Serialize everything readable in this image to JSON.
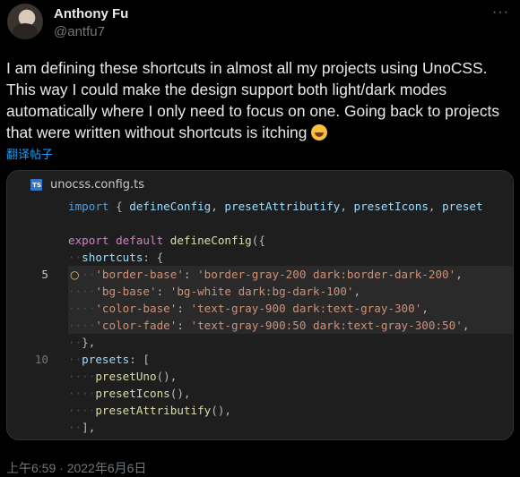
{
  "author": {
    "name": "Anthony Fu",
    "handle": "@antfu7"
  },
  "tweet": {
    "text": "I am defining these shortcuts in almost all my projects using UnoCSS. This way I could make the design support both light/dark modes automatically where I only need to focus on one. Going back to projects that were written without shortcuts is itching",
    "emoji": "rolling-on-the-floor-laughing",
    "translate_label": "翻译帖子",
    "more_label": "···"
  },
  "code_card": {
    "file_badge": "TS",
    "filename": "unocss.config.ts",
    "lines": [
      {
        "num": "",
        "tokens": [
          [
            "k",
            "import"
          ],
          [
            "pun",
            " { "
          ],
          [
            "p",
            "defineConfig"
          ],
          [
            "pun",
            ", "
          ],
          [
            "p",
            "presetAttributify"
          ],
          [
            "pun",
            ", "
          ],
          [
            "p",
            "presetIcons"
          ],
          [
            "pun",
            ", "
          ],
          [
            "p",
            "preset"
          ]
        ]
      },
      {
        "num": "",
        "tokens": []
      },
      {
        "num": "",
        "tokens": [
          [
            "kw",
            "export"
          ],
          [
            "pun",
            " "
          ],
          [
            "kw",
            "default"
          ],
          [
            "pun",
            " "
          ],
          [
            "f",
            "defineConfig"
          ],
          [
            "pun",
            "({"
          ]
        ]
      },
      {
        "num": "",
        "tokens": [
          [
            "dot",
            "··"
          ],
          [
            "p",
            "shortcuts"
          ],
          [
            "pun",
            ": {"
          ]
        ]
      },
      {
        "num": "5",
        "tokens": [
          [
            "dot",
            "····"
          ],
          [
            "s",
            "'border-base'"
          ],
          [
            "pun",
            ": "
          ],
          [
            "s",
            "'border-gray-200 dark:border-dark-200'"
          ],
          [
            "pun",
            ","
          ]
        ]
      },
      {
        "num": "",
        "tokens": [
          [
            "dot",
            "····"
          ],
          [
            "s",
            "'bg-base'"
          ],
          [
            "pun",
            ": "
          ],
          [
            "s",
            "'bg-white dark:bg-dark-100'"
          ],
          [
            "pun",
            ","
          ]
        ]
      },
      {
        "num": "",
        "tokens": [
          [
            "dot",
            "····"
          ],
          [
            "s",
            "'color-base'"
          ],
          [
            "pun",
            ": "
          ],
          [
            "s",
            "'text-gray-900 dark:text-gray-300'"
          ],
          [
            "pun",
            ","
          ]
        ]
      },
      {
        "num": "",
        "tokens": [
          [
            "dot",
            "····"
          ],
          [
            "s",
            "'color-fade'"
          ],
          [
            "pun",
            ": "
          ],
          [
            "s",
            "'text-gray-900:50 dark:text-gray-300:50'"
          ],
          [
            "pun",
            ","
          ]
        ]
      },
      {
        "num": "",
        "tokens": [
          [
            "dot",
            "··"
          ],
          [
            "pun",
            "},"
          ]
        ]
      },
      {
        "num": "10",
        "tokens": [
          [
            "dot",
            "··"
          ],
          [
            "p",
            "presets"
          ],
          [
            "pun",
            ": ["
          ]
        ]
      },
      {
        "num": "",
        "tokens": [
          [
            "dot",
            "····"
          ],
          [
            "f",
            "presetUno"
          ],
          [
            "pun",
            "(),"
          ]
        ]
      },
      {
        "num": "",
        "tokens": [
          [
            "dot",
            "····"
          ],
          [
            "f",
            "presetIcons"
          ],
          [
            "pun",
            "(),"
          ]
        ]
      },
      {
        "num": "",
        "tokens": [
          [
            "dot",
            "····"
          ],
          [
            "f",
            "presetAttributify"
          ],
          [
            "pun",
            "(),"
          ]
        ]
      },
      {
        "num": "",
        "tokens": [
          [
            "dot",
            "··"
          ],
          [
            "pun",
            "],"
          ]
        ]
      }
    ]
  },
  "timestamp": "上午6:59 · 2022年6月6日"
}
